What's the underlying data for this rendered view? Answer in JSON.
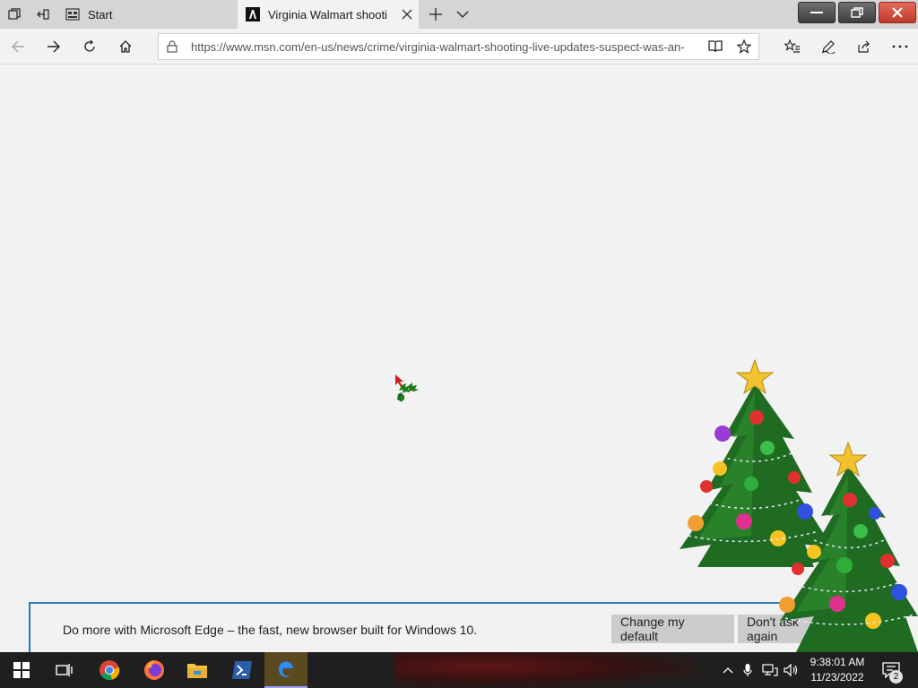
{
  "browser": {
    "tabs": [
      {
        "label": "Start",
        "icon": "newtab-page-icon",
        "active": false
      },
      {
        "label": "Virginia Walmart shooti",
        "icon": "msn-favicon",
        "active": true
      }
    ],
    "address_url": "https://www.msn.com/en-us/news/crime/virginia-walmart-shooting-live-updates-suspect-was-an-"
  },
  "banner": {
    "text": "Do more with Microsoft Edge – the fast, new browser built for Windows 10.",
    "change_default_label": "Change my default",
    "dont_ask_label": "Don't ask again"
  },
  "taskbar": {
    "apps": [
      "windows-start",
      "task-view",
      "chrome",
      "firefox",
      "file-explorer",
      "powershell",
      "edge"
    ],
    "time": "9:38:01 AM",
    "date": "11/23/2022",
    "notification_count": "2"
  },
  "colors": {
    "tabbar": "#d5d5d5",
    "page": "#f2f2f2",
    "banner_border": "#2b7cb5",
    "taskbar": "#1f1f1f",
    "close_button": "#c0392b"
  }
}
